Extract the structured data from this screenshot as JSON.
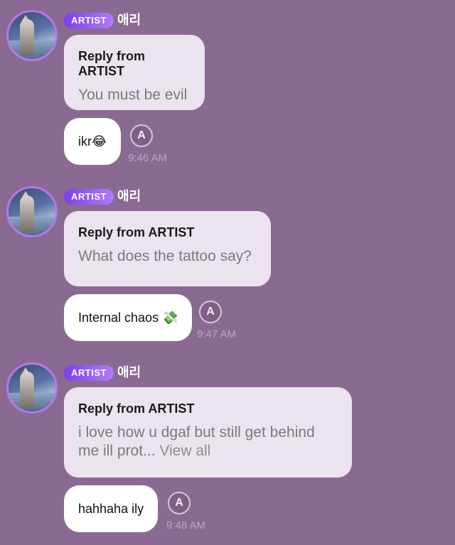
{
  "messages": [
    {
      "badge": "ARTIST",
      "name": "애리",
      "reply_title": "Reply from ARTIST",
      "reply_text": "You must be evil",
      "reply_more": "",
      "message": "ikr😂",
      "time": "9:46 AM"
    },
    {
      "badge": "ARTIST",
      "name": "애리",
      "reply_title": "Reply from ARTIST",
      "reply_text": "What does the tattoo say?",
      "reply_more": "",
      "message": "Internal chaos 💸",
      "time": "9:47 AM"
    },
    {
      "badge": "ARTIST",
      "name": "애리",
      "reply_title": "Reply from ARTIST",
      "reply_text": "i love how u dgaf but still get behind me ill prot...",
      "reply_more": " View all",
      "message": "hahhaha ily",
      "time": "9:48 AM"
    }
  ],
  "translate_glyph": "A",
  "translate_icon": "translate-icon",
  "colors": {
    "background": "#8a6a92",
    "badge_start": "#7b3ff0",
    "badge_end": "#b27cf7",
    "avatar_ring": "#b775f0"
  }
}
